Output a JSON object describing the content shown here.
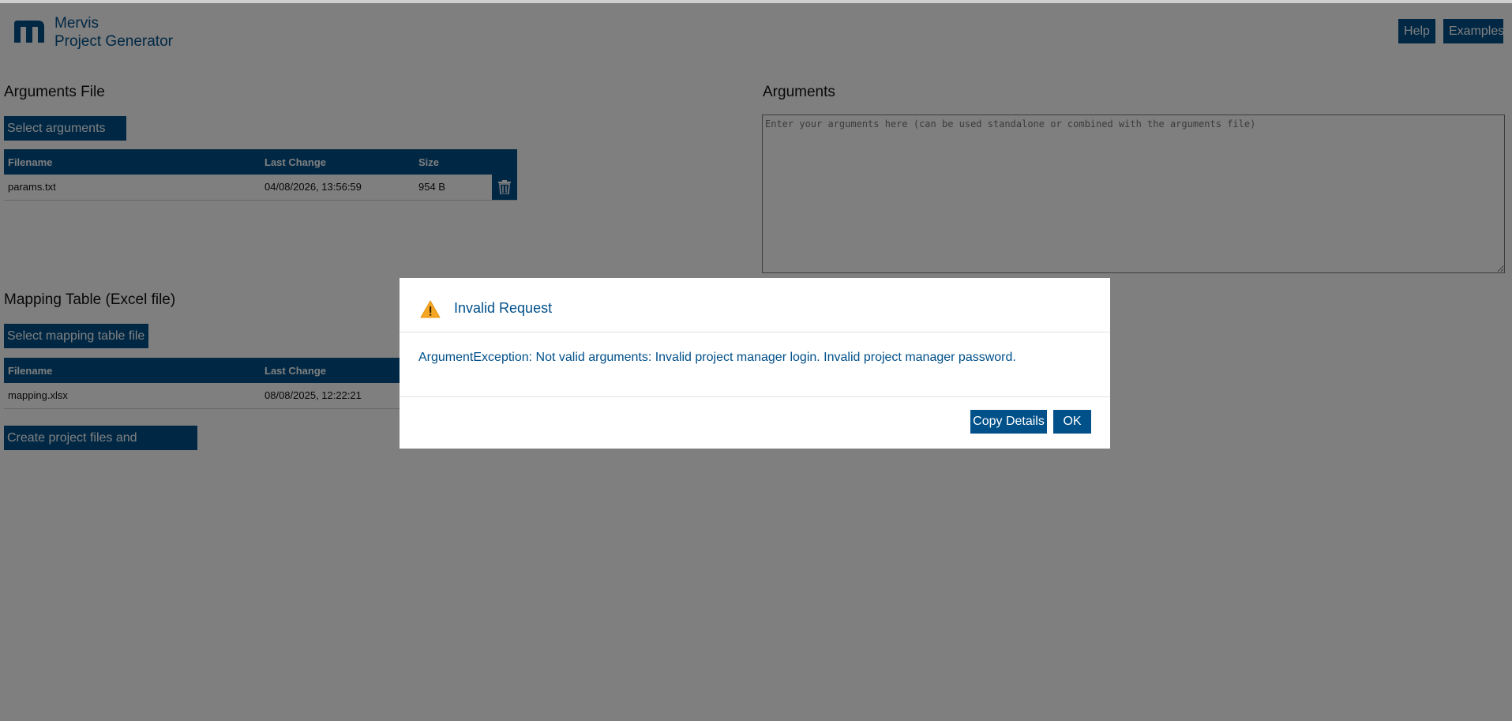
{
  "header": {
    "brand_line1": "Mervis",
    "brand_line2": "Project Generator",
    "help_label": "Help",
    "examples_label": "Examples"
  },
  "arguments_file": {
    "title": "Arguments File",
    "select_label": "Select arguments file",
    "columns": [
      "Filename",
      "Last Change",
      "Size"
    ],
    "rows": [
      {
        "filename": "params.txt",
        "last_change": "04/08/2026, 13:56:59",
        "size": "954 B"
      }
    ]
  },
  "arguments": {
    "title": "Arguments",
    "placeholder": "Enter your arguments here (can be used standalone or combined with the arguments file)",
    "value": ""
  },
  "mapping_table": {
    "title": "Mapping Table (Excel file)",
    "select_label": "Select mapping table file",
    "columns": [
      "Filename",
      "Last Change"
    ],
    "rows": [
      {
        "filename": "mapping.xlsx",
        "last_change": "08/08/2025, 12:22:21"
      }
    ]
  },
  "create_label": "Create project files and download",
  "dialog": {
    "title": "Invalid Request",
    "message": "ArgumentException: Not valid arguments: Invalid project manager login. Invalid project manager password.",
    "copy_label": "Copy Details",
    "ok_label": "OK"
  },
  "icons": {
    "logo": "mervis-logo-icon",
    "delete": "trash-icon",
    "warning": "warning-icon"
  },
  "colors": {
    "accent": "#00508a",
    "warning": "#f5a623"
  }
}
